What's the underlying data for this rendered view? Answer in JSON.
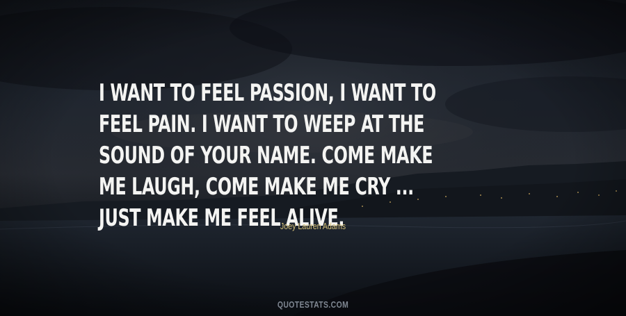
{
  "quote": {
    "text": "I want to feel passion, I want to feel pain. I want to weep at the sound of your name. Come make me laugh, come make me cry ... Just make me feel alive.",
    "author": "Joey Lauren Adams"
  },
  "watermark": "QUOTESTATS.COM",
  "colors": {
    "quote_text": "#f4f4f2",
    "author_text": "#d6c27a",
    "watermark_text": "#7f8792"
  }
}
